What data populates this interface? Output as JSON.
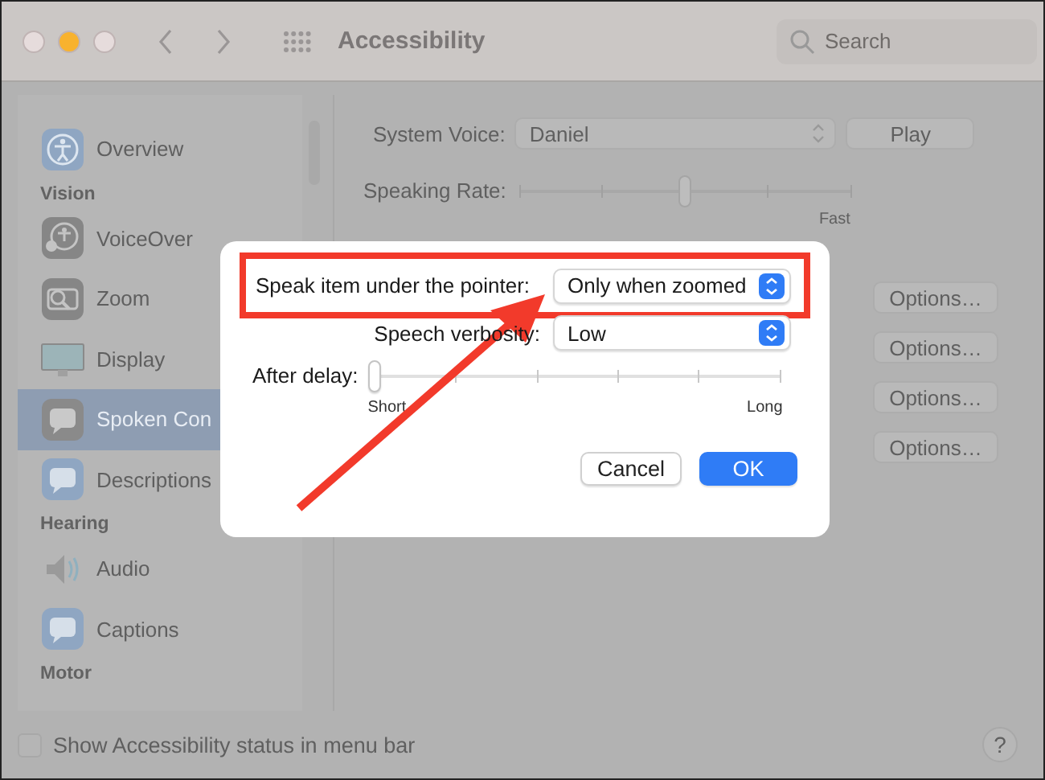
{
  "window": {
    "title": "Accessibility",
    "lights": [
      {
        "color": "#e6dcdc"
      },
      {
        "color": "#f8b22e"
      },
      {
        "color": "#e6dcdc"
      }
    ]
  },
  "search": {
    "placeholder": "Search"
  },
  "sidebar": {
    "items": [
      {
        "kind": "item",
        "label": "Overview",
        "selected": false
      },
      {
        "kind": "section",
        "label": "Vision"
      },
      {
        "kind": "item",
        "label": "VoiceOver",
        "selected": false
      },
      {
        "kind": "item",
        "label": "Zoom",
        "selected": false
      },
      {
        "kind": "item",
        "label": "Display",
        "selected": false
      },
      {
        "kind": "item",
        "label": "Spoken Con",
        "selected": true
      },
      {
        "kind": "item",
        "label": "Descriptions",
        "selected": false
      },
      {
        "kind": "section",
        "label": "Hearing"
      },
      {
        "kind": "item",
        "label": "Audio",
        "selected": false
      },
      {
        "kind": "item",
        "label": "Captions",
        "selected": false
      },
      {
        "kind": "section",
        "label": "Motor"
      }
    ]
  },
  "system_voice": {
    "label": "System Voice:",
    "value": "Daniel"
  },
  "play_button": "Play",
  "speaking_rate": {
    "label": "Speaking Rate:",
    "level": 0.5,
    "max_label": "Fast"
  },
  "options_buttons": [
    "Options…",
    "Options…",
    "Options…",
    "Options…"
  ],
  "status_checkbox": {
    "label": "Show Accessibility status in menu bar",
    "checked": false
  },
  "help_button": "?",
  "dialog": {
    "pointer_select": {
      "label": "Speak item under the pointer:",
      "value": "Only when zoomed"
    },
    "verbosity_select": {
      "label": "Speech verbosity:",
      "value": "Low"
    },
    "delay": {
      "label": "After delay:",
      "level": 0,
      "min_label": "Short",
      "max_label": "Long"
    },
    "buttons": [
      {
        "label": "Cancel",
        "default": false
      },
      {
        "label": "OK",
        "default": true
      }
    ]
  }
}
